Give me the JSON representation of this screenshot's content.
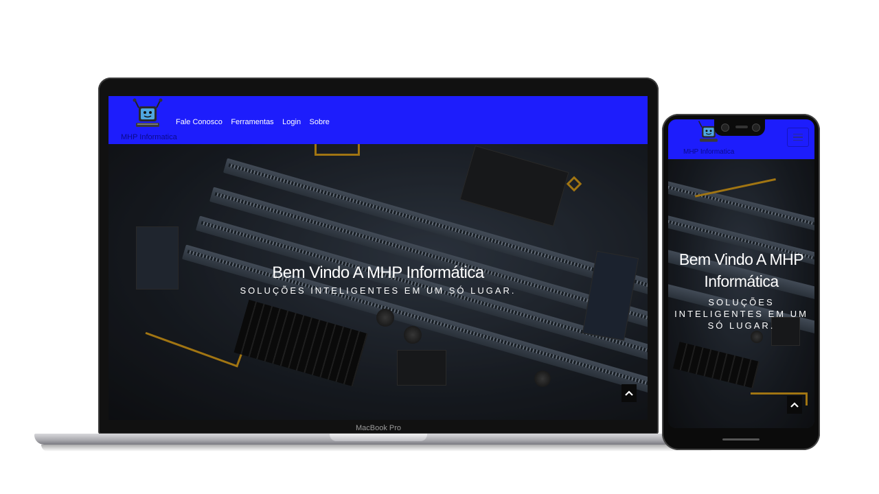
{
  "site": {
    "brand": "MHP Informatica",
    "nav_links": [
      "Fale Conosco",
      "Ferramentas",
      "Login",
      "Sobre"
    ],
    "hero": {
      "title": "Bem Vindo A MHP Informática",
      "subtitle": "Soluções inteligentes em um só lugar."
    }
  },
  "laptop": {
    "model_label": "MacBook Pro"
  },
  "colors": {
    "nav_bg": "#1d1dfc",
    "brand_text": "#0a0a8a",
    "accent_gold": "#e0a21a"
  },
  "icons": {
    "logo": "computer-robot-icon",
    "back_to_top": "chevron-up-icon",
    "menu": "hamburger-menu-icon"
  }
}
